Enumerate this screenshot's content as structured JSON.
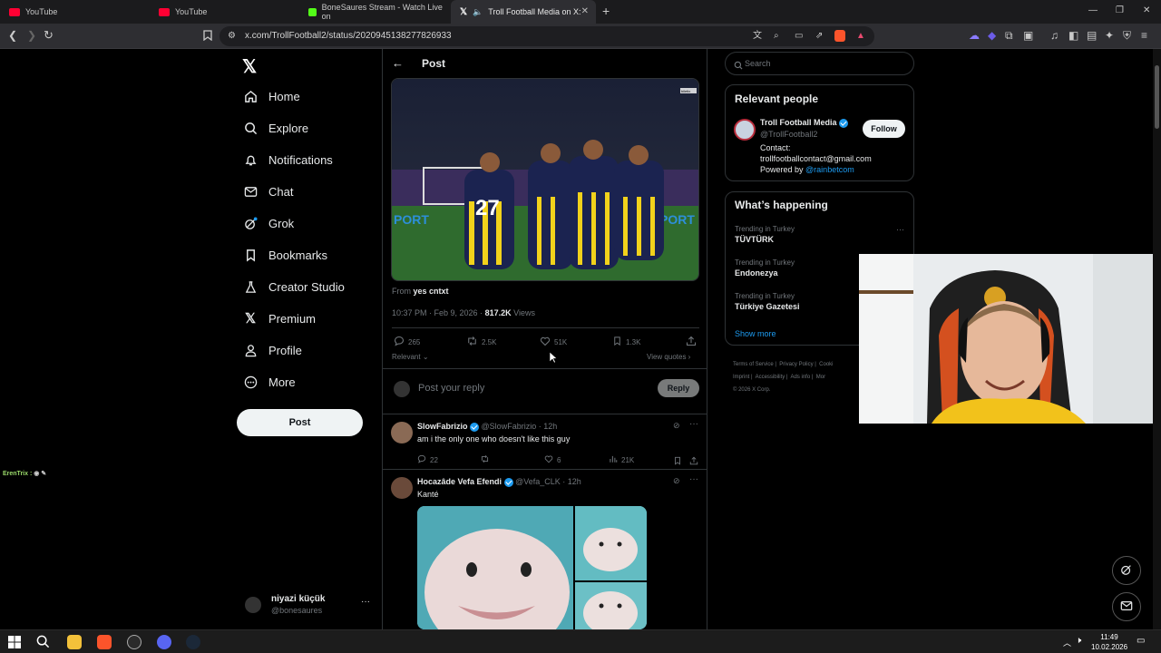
{
  "browser": {
    "tabs": [
      {
        "title": "YouTube"
      },
      {
        "title": "YouTube"
      },
      {
        "title": "BoneSaures Stream - Watch Live on"
      },
      {
        "title": "Troll Football Media on X: \"K..."
      }
    ],
    "url": "x.com/TrollFootball2/status/2020945138277826933"
  },
  "nav": {
    "items": [
      {
        "label": "Home",
        "icon": "home-icon"
      },
      {
        "label": "Explore",
        "icon": "search-icon"
      },
      {
        "label": "Notifications",
        "icon": "bell-icon"
      },
      {
        "label": "Chat",
        "icon": "mail-icon"
      },
      {
        "label": "Grok",
        "icon": "grok-icon"
      },
      {
        "label": "Bookmarks",
        "icon": "bookmark-icon"
      },
      {
        "label": "Creator Studio",
        "icon": "flask-icon"
      },
      {
        "label": "Premium",
        "icon": "x-logo-icon"
      },
      {
        "label": "Profile",
        "icon": "person-icon"
      },
      {
        "label": "More",
        "icon": "more-circle-icon"
      }
    ],
    "post_button": "Post",
    "account": {
      "name": "niyazi küçük",
      "handle": "@bonesaures"
    }
  },
  "chat_overlay": {
    "text": "ErenTrix :"
  },
  "post": {
    "header_title": "Post",
    "media_badge": "biletix",
    "shirt_number": "27",
    "from_label": "From",
    "from_name": "yes cntxt",
    "timestamp": "10:37 PM · Feb 9, 2026 ·",
    "views_count": "817.2K",
    "views_label": "Views",
    "stats": {
      "replies": "265",
      "reposts": "2.5K",
      "likes": "51K",
      "bookmarks": "1.3K"
    },
    "sort_label": "Relevant",
    "view_quotes": "View quotes",
    "reply_placeholder": "Post your reply",
    "reply_button": "Reply"
  },
  "replies": [
    {
      "name": "SlowFabrizio",
      "handle": "@SlowFabrizio",
      "time": "· 12h",
      "text": "am i the only one who doesn't like this guy",
      "stats": {
        "replies": "22",
        "reposts": "",
        "likes": "6",
        "views": "21K"
      }
    },
    {
      "name": "Hocazâde Vefa Efendi",
      "handle": "@Vefa_CLK",
      "time": "· 12h",
      "text": "Kanté"
    }
  ],
  "sidebar": {
    "search_placeholder": "Search",
    "relevant_title": "Relevant people",
    "person": {
      "name": "Troll Football Media",
      "handle": "@TrollFootball2",
      "follow": "Follow",
      "bio_line1": "Contact:",
      "bio_line2": "trollfootballcontact@gmail.com",
      "bio_line3": "Powered by",
      "bio_link": "@rainbetcom"
    },
    "happening_title": "What’s happening",
    "trends": [
      {
        "context": "Trending in Turkey",
        "name": "TÜVTÜRK"
      },
      {
        "context": "Trending in Turkey",
        "name": "Endonezya"
      },
      {
        "context": "Trending in Turkey",
        "name": "Türkiye Gazetesi"
      }
    ],
    "show_more": "Show more",
    "footer": [
      "Terms of Service",
      "Privacy Policy",
      "Cooki",
      "Imprint",
      "Accessibility",
      "Ads info",
      "Mor",
      "© 2026 X Corp."
    ]
  },
  "taskbar": {
    "time": "11:49",
    "date": "10.02.2026"
  },
  "colors": {
    "accent": "#1d9bf0",
    "background": "#000000",
    "text": "#e7e9ea",
    "muted": "#71767b"
  }
}
